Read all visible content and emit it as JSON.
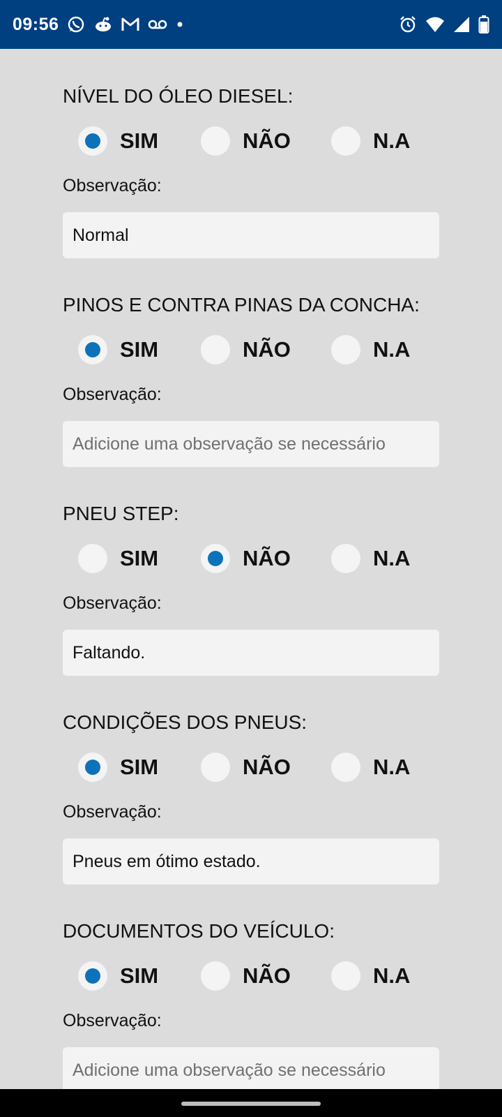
{
  "status_bar": {
    "time": "09:56",
    "left_icons": [
      "whatsapp-icon",
      "reddit-icon",
      "gmail-icon",
      "voicemail-icon",
      "dot-icon"
    ],
    "right_icons": [
      "alarm-icon",
      "wifi-icon",
      "signal-icon",
      "battery-icon"
    ],
    "background_color": "#003f80"
  },
  "option_labels": {
    "sim": "SIM",
    "nao": "NÃO",
    "na": "N.A"
  },
  "accent_color": "#0d72b9",
  "sections": [
    {
      "title": "NÍVEL DO ÓLEO DIESEL:",
      "selected": "sim",
      "observation_label": "Observação:",
      "observation_value": "Normal",
      "observation_placeholder": "Adicione uma observação se necessário"
    },
    {
      "title": "PINOS E CONTRA PINAS DA CONCHA:",
      "selected": "sim",
      "observation_label": "Observação:",
      "observation_value": "",
      "observation_placeholder": "Adicione uma observação se necessário"
    },
    {
      "title": "PNEU STEP:",
      "selected": "nao",
      "observation_label": "Observação:",
      "observation_value": "Faltando.",
      "observation_placeholder": "Adicione uma observação se necessário"
    },
    {
      "title": "CONDIÇÕES DOS PNEUS:",
      "selected": "sim",
      "observation_label": "Observação:",
      "observation_value": "Pneus em ótimo estado.",
      "observation_placeholder": "Adicione uma observação se necessário"
    },
    {
      "title": "DOCUMENTOS DO VEÍCULO:",
      "selected": "sim",
      "observation_label": "Observação:",
      "observation_value": "",
      "observation_placeholder": "Adicione uma observação se necessário"
    }
  ]
}
